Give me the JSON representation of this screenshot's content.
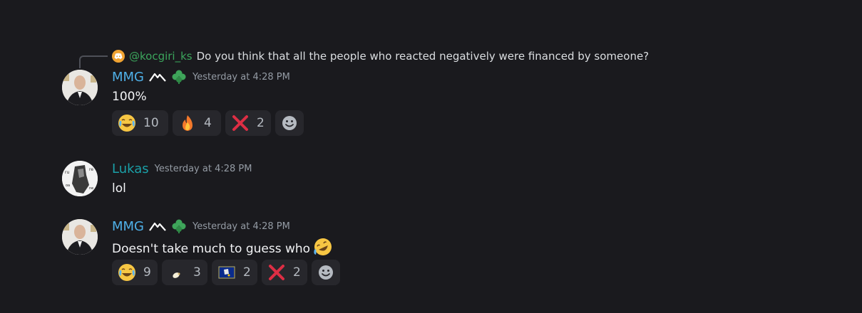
{
  "reply": {
    "mention": "@kocgiri_ks",
    "text": "Do you think that all the people who reacted negatively were financed by someone?"
  },
  "messages": [
    {
      "author": "MMG",
      "timestamp": "Yesterday at 4:28 PM",
      "content": "100%",
      "reactions": [
        {
          "emoji": "joy-emoji",
          "count": "10"
        },
        {
          "emoji": "fire-emoji",
          "count": "4"
        },
        {
          "emoji": "cross-mark-emoji",
          "count": "2"
        }
      ]
    },
    {
      "author": "Lukas",
      "timestamp": "Yesterday at 4:28 PM",
      "content": "lol"
    },
    {
      "author": "MMG",
      "timestamp": "Yesterday at 4:28 PM",
      "content": "Doesn't take much to guess who",
      "reactions": [
        {
          "emoji": "joy-emoji",
          "count": "9"
        },
        {
          "emoji": "custom-emoji",
          "count": "3"
        },
        {
          "emoji": "flag-emoji",
          "count": "2"
        },
        {
          "emoji": "cross-mark-emoji",
          "count": "2"
        }
      ]
    }
  ],
  "colors": {
    "background": "#1a1a1e",
    "mmg_name": "#4fb0e8",
    "lukas_name": "#1aa0a8",
    "reply_mention": "#3ba55c",
    "timestamp": "#949ba4",
    "reaction_bg": "#27272c"
  }
}
